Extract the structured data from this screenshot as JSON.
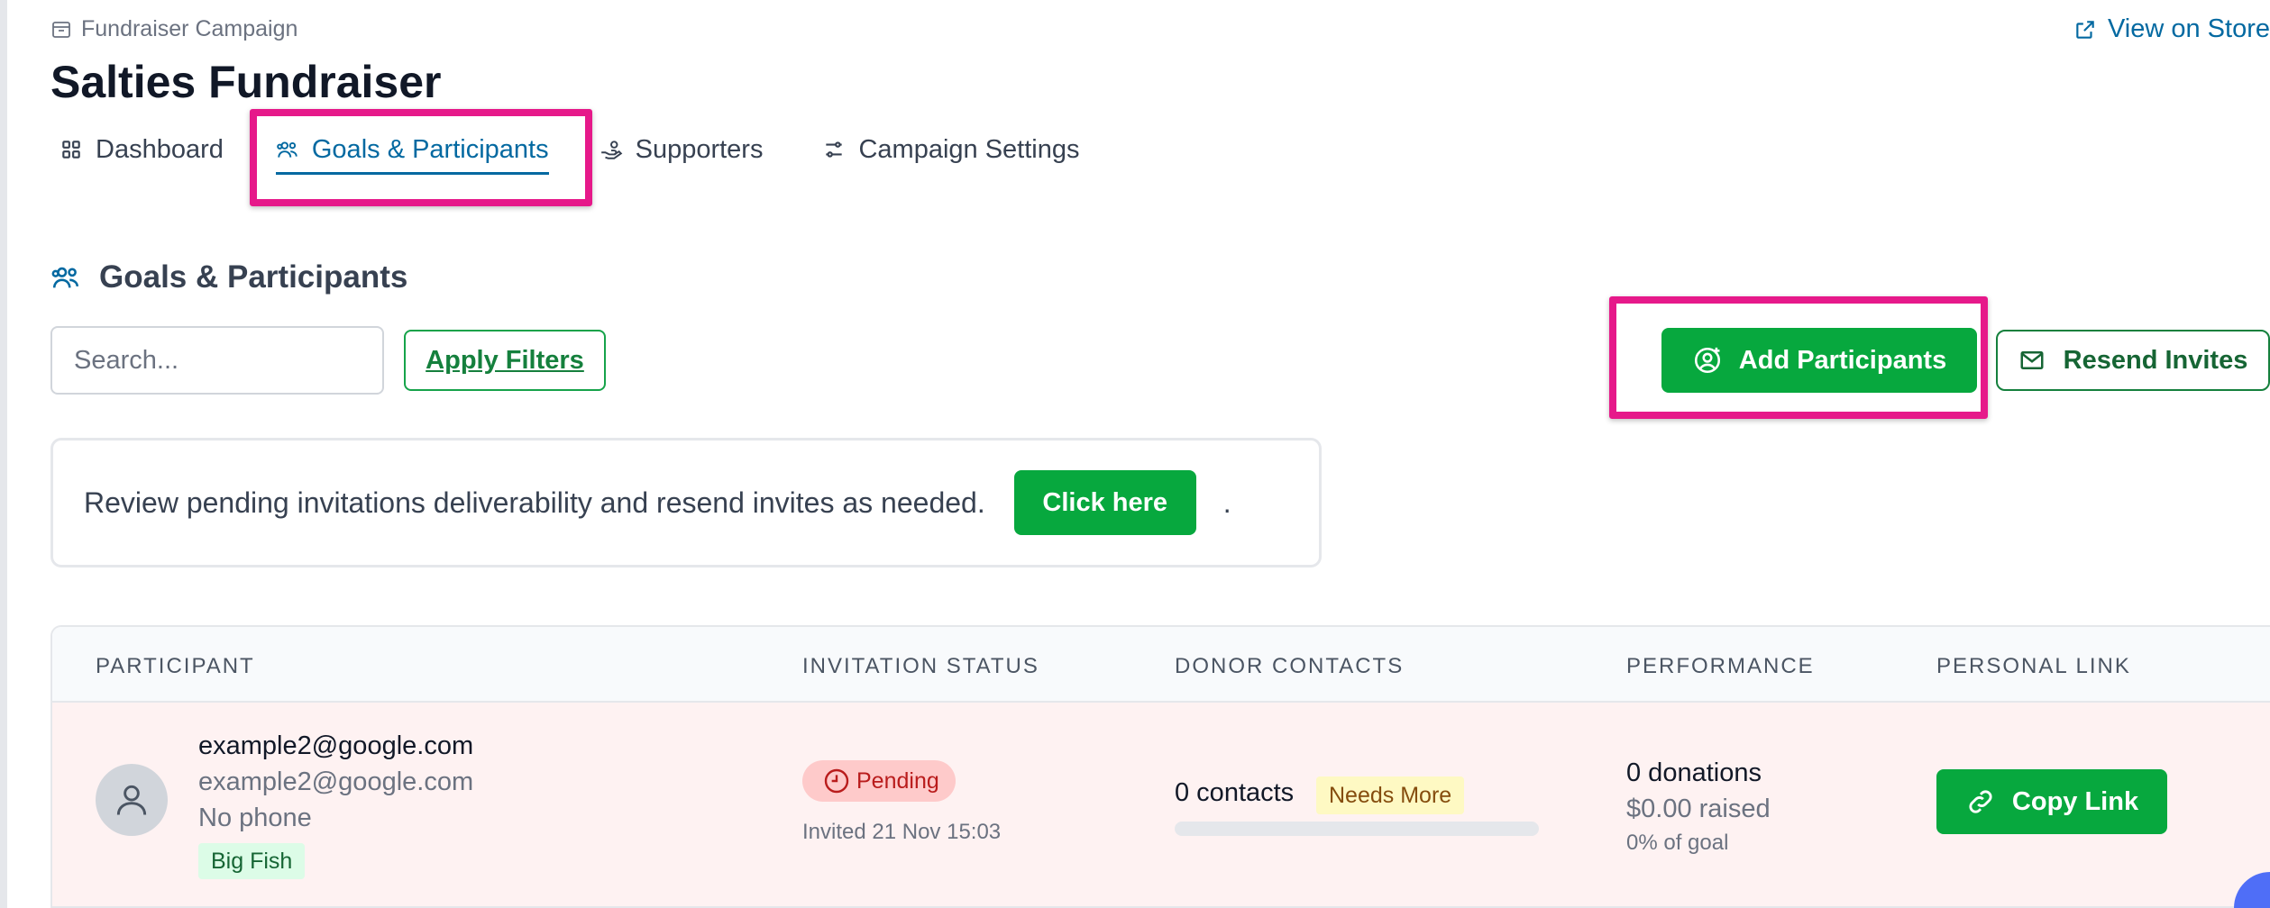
{
  "breadcrumb": {
    "label": "Fundraiser Campaign",
    "icon": "archive-box-icon"
  },
  "header": {
    "title": "Salties Fundraiser",
    "view_store_label": "View on Store",
    "view_store_icon": "external-link-icon"
  },
  "tabs": [
    {
      "label": "Dashboard",
      "icon": "grid-icon",
      "active": false
    },
    {
      "label": "Goals & Participants",
      "icon": "users-icon",
      "active": true
    },
    {
      "label": "Supporters",
      "icon": "hand-coins-icon",
      "active": false
    },
    {
      "label": "Campaign Settings",
      "icon": "sliders-icon",
      "active": false
    }
  ],
  "section": {
    "title": "Goals & Participants",
    "icon": "users-icon"
  },
  "toolbar": {
    "search_placeholder": "Search...",
    "apply_filters_label": "Apply Filters",
    "add_participants_label": "Add Participants",
    "resend_invites_label": "Resend Invites"
  },
  "notice": {
    "text": "Review pending invitations deliverability and resend invites as needed.",
    "button_label": "Click here",
    "suffix": "."
  },
  "table": {
    "columns": [
      "PARTICIPANT",
      "INVITATION STATUS",
      "DONOR CONTACTS",
      "PERFORMANCE",
      "PERSONAL LINK"
    ],
    "rows": [
      {
        "name": "example2@google.com",
        "email": "example2@google.com",
        "phone": "No phone",
        "tag": "Big Fish",
        "status": "Pending",
        "invited": "Invited 21 Nov 15:03",
        "contacts": "0 contacts",
        "contacts_badge": "Needs More",
        "contacts_progress": 0,
        "donations": "0 donations",
        "raised": "$0.00 raised",
        "goal_pct": "0% of goal",
        "link_label": "Copy Link"
      }
    ]
  },
  "colors": {
    "primary_green": "#07a83e",
    "link_blue": "#0369a1",
    "highlight_pink": "#e6198a",
    "row_pending_bg": "#fef2f2"
  }
}
